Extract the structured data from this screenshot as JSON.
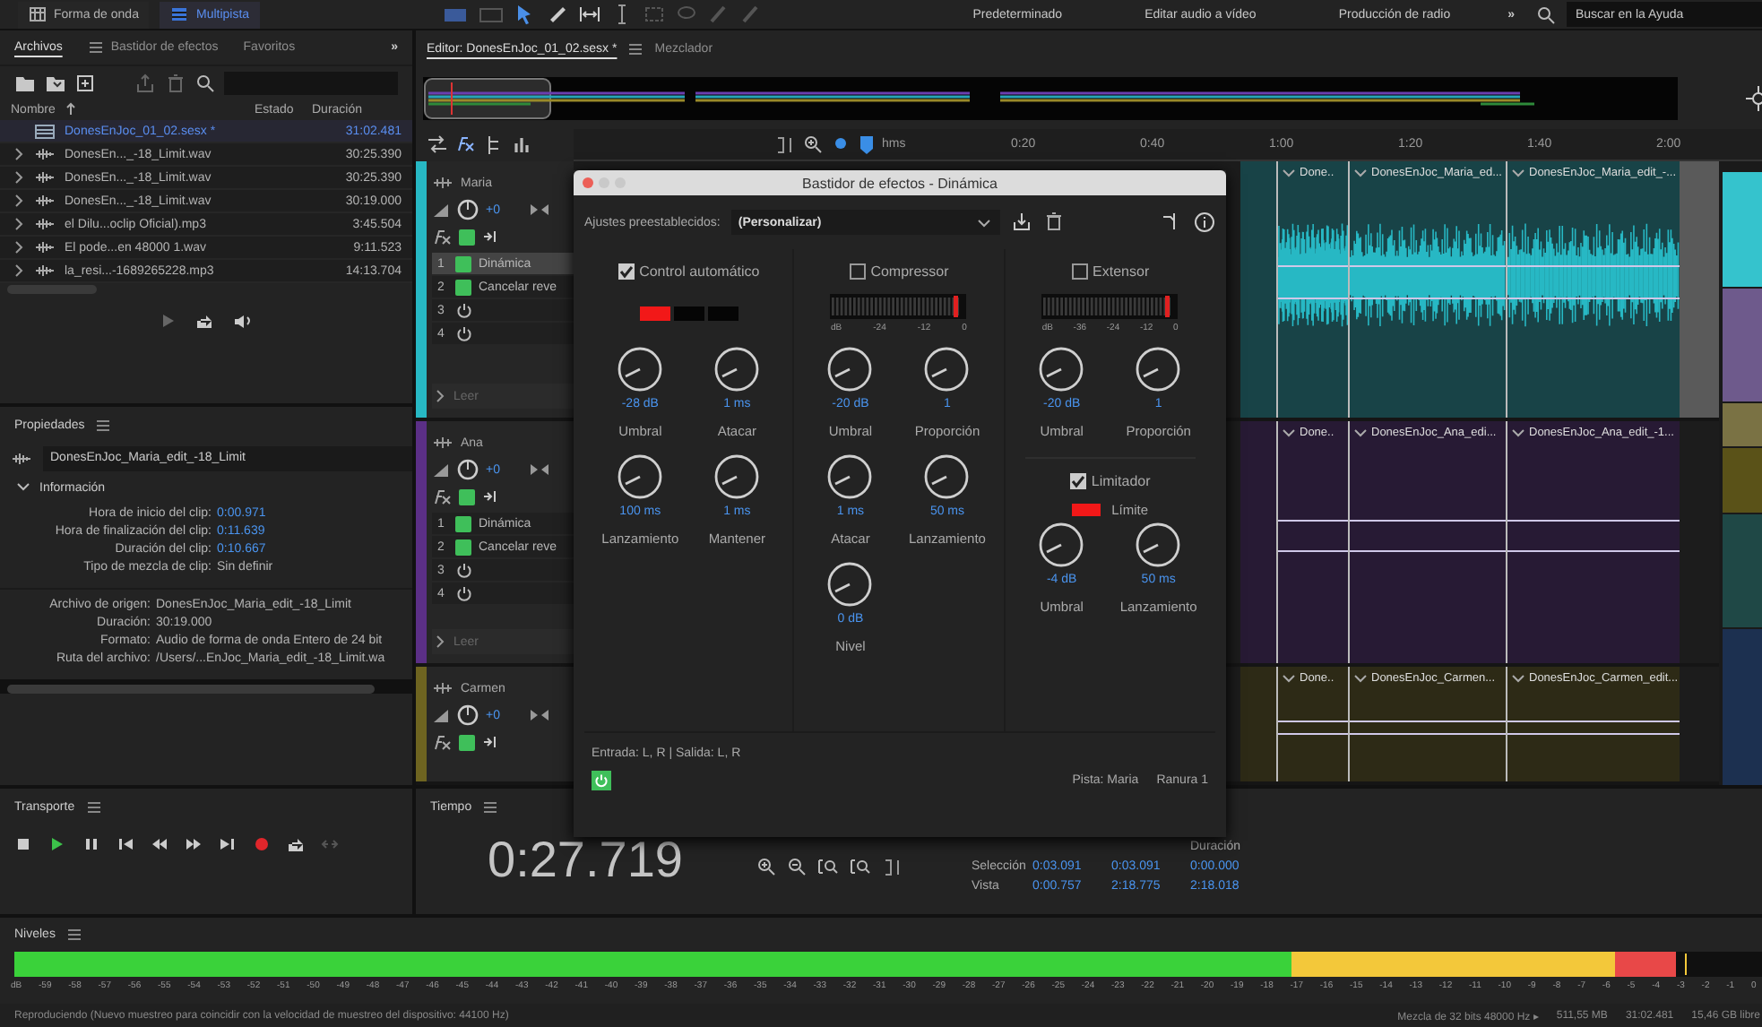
{
  "top_bar": {
    "view_buttons": [
      {
        "label": "Forma de onda",
        "selected": false
      },
      {
        "label": "Multipista",
        "selected": true
      }
    ],
    "workspaces": [
      "Predeterminado",
      "Editar audio a vídeo",
      "Producción de radio"
    ],
    "more": "»",
    "search": {
      "placeholder": "Buscar en la Ayuda"
    }
  },
  "files_panel": {
    "tabs": [
      {
        "label": "Archivos",
        "selected": true
      },
      {
        "label": "Bastidor de efectos",
        "selected": false
      },
      {
        "label": "Favoritos",
        "selected": false
      }
    ],
    "more": "»",
    "columns": [
      "Nombre",
      "Estado",
      "Duración"
    ],
    "rows": [
      {
        "name": "DonesEnJoc_01_02.sesx *",
        "kind": "session",
        "duration": "31:02.481",
        "selected": true
      },
      {
        "name": "DonesEn..._-18_Limit.wav",
        "kind": "audio",
        "duration": "30:25.390",
        "selected": false
      },
      {
        "name": "DonesEn..._-18_Limit.wav",
        "kind": "audio",
        "duration": "30:25.390",
        "selected": false
      },
      {
        "name": "DonesEn..._-18_Limit.wav",
        "kind": "audio",
        "duration": "30:19.000",
        "selected": false
      },
      {
        "name": "el Dilu...oclip Oficial).mp3",
        "kind": "audio",
        "duration": "3:45.504",
        "selected": false
      },
      {
        "name": "El pode...en 48000 1.wav",
        "kind": "audio",
        "duration": "9:11.523",
        "selected": false
      },
      {
        "name": "la_resi...-1689265228.mp3",
        "kind": "audio",
        "duration": "14:13.704",
        "selected": false
      }
    ]
  },
  "properties": {
    "title": "Propiedades",
    "clip_name": "DonesEnJoc_Maria_edit_-18_Limit",
    "section": {
      "label": "Información",
      "expanded": true
    },
    "clip_fields": [
      {
        "label": "Hora de inicio del clip:",
        "value": "0:00.971",
        "kind": "link"
      },
      {
        "label": "Hora de finalización del clip:",
        "value": "0:11.639",
        "kind": "link"
      },
      {
        "label": "Duración del clip:",
        "value": "0:10.667",
        "kind": "link"
      },
      {
        "label": "Tipo de mezcla de clip:",
        "value": "Sin definir",
        "kind": "plain"
      }
    ],
    "file_fields": [
      {
        "label": "Archivo de origen:",
        "value": "DonesEnJoc_Maria_edit_-18_Limit"
      },
      {
        "label": "Duración:",
        "value": "30:19.000"
      },
      {
        "label": "Formato:",
        "value": "Audio de forma de onda Entero de 24 bit"
      },
      {
        "label": "Ruta del archivo:",
        "value": "/Users/...EnJoc_Maria_edit_-18_Limit.wa"
      }
    ]
  },
  "editor": {
    "tabs": [
      {
        "label": "Editor: DonesEnJoc_01_02.sesx *",
        "selected": true
      },
      {
        "label": "Mezclador",
        "selected": false
      }
    ],
    "ruler": [
      "hms",
      "0:20",
      "0:40",
      "1:00",
      "1:20",
      "1:40",
      "2:00"
    ],
    "tracks": [
      {
        "name": "Maria",
        "color": "#27b8c4",
        "volume": "+0",
        "fx_power": true,
        "waveform": true,
        "effects": [
          {
            "slot": "1",
            "kind": "effect",
            "name": "Dinámica",
            "on": true,
            "selected": true
          },
          {
            "slot": "2",
            "kind": "effect",
            "name": "Cancelar reve",
            "on": true,
            "selected": false
          },
          {
            "slot": "3",
            "kind": "empty",
            "selected": false
          },
          {
            "slot": "4",
            "kind": "empty",
            "selected": false
          }
        ],
        "automation": "Leer",
        "clips": [
          "Done..",
          "DonesEnJoc_Maria_ed...",
          "DonesEnJoc_Maria_edit_-..."
        ]
      },
      {
        "name": "Ana",
        "color": "#5b2f86",
        "volume": "+0",
        "fx_power": true,
        "waveform": false,
        "effects": [
          {
            "slot": "1",
            "kind": "effect",
            "name": "Dinámica",
            "on": true,
            "selected": false
          },
          {
            "slot": "2",
            "kind": "effect",
            "name": "Cancelar reve",
            "on": true,
            "selected": false
          },
          {
            "slot": "3",
            "kind": "empty",
            "selected": false
          },
          {
            "slot": "4",
            "kind": "empty",
            "selected": false
          }
        ],
        "automation": "Leer",
        "clips": [
          "Done..",
          "DonesEnJoc_Ana_edi...",
          "DonesEnJoc_Ana_edit_-1..."
        ]
      },
      {
        "name": "Carmen",
        "color": "#6e6420",
        "volume": "+0",
        "fx_power": true,
        "waveform": false,
        "clips": [
          "Done..",
          "DonesEnJoc_Carmen...",
          "DonesEnJoc_Carmen_edit..."
        ]
      }
    ]
  },
  "dialog": {
    "title": "Bastidor de efectos - Dinámica",
    "presets_label": "Ajustes preestablecidos:",
    "preset": "(Personalizar)",
    "sections": [
      {
        "kind": "autogain",
        "label": "Control automático",
        "checked": true,
        "lights": [
          {
            "on": true
          },
          {
            "on": false
          },
          {
            "on": false
          }
        ],
        "knobs": [
          {
            "value": "-28 dB",
            "label": "Umbral"
          },
          {
            "value": "1 ms",
            "label": "Atacar"
          },
          {
            "value": "100 ms",
            "label": "Lanzamiento"
          },
          {
            "value": "1 ms",
            "label": "Mantener"
          }
        ]
      },
      {
        "kind": "meter",
        "label": "Compressor",
        "checked": false,
        "scale": [
          "dB",
          "-24",
          "-12",
          "0"
        ],
        "knobs": [
          {
            "value": "-20 dB",
            "label": "Umbral"
          },
          {
            "value": "1",
            "label": "Proporción"
          },
          {
            "value": "1 ms",
            "label": "Atacar"
          },
          {
            "value": "50 ms",
            "label": "Lanzamiento"
          },
          {
            "value": "0 dB",
            "label": "Nivel"
          }
        ]
      },
      {
        "kind": "meter",
        "label": "Extensor",
        "checked": false,
        "scale": [
          "dB",
          "-36",
          "-24",
          "-12",
          "0"
        ],
        "knobs": [
          {
            "value": "-20 dB",
            "label": "Umbral"
          },
          {
            "value": "1",
            "label": "Proporción"
          }
        ],
        "limiter": {
          "label": "Limitador",
          "checked": true,
          "indicator": {
            "label": "Límite",
            "on": true
          },
          "knobs": [
            {
              "value": "-4 dB",
              "label": "Umbral"
            },
            {
              "value": "50 ms",
              "label": "Lanzamiento"
            }
          ]
        }
      }
    ],
    "io": "Entrada: L, R | Salida: L, R",
    "power_on": true,
    "track": "Pista: Maria",
    "slot": "Ranura 1"
  },
  "transport": {
    "title": "Transporte"
  },
  "time": {
    "title": "Tiempo",
    "display": "0:27.719"
  },
  "selection": {
    "columns": [
      "Duración"
    ],
    "rows": [
      {
        "label": "Selección",
        "values": [
          "0:03.091",
          "0:03.091",
          "0:00.000"
        ]
      },
      {
        "label": "Vista",
        "values": [
          "0:00.757",
          "2:18.775",
          "2:18.018"
        ]
      }
    ]
  },
  "levels": {
    "title": "Niveles",
    "level": 0.95,
    "scale": [
      "dB",
      "-59",
      "-58",
      "-57",
      "-56",
      "-55",
      "-54",
      "-53",
      "-52",
      "-51",
      "-50",
      "-49",
      "-48",
      "-47",
      "-46",
      "-45",
      "-44",
      "-43",
      "-42",
      "-41",
      "-40",
      "-39",
      "-38",
      "-37",
      "-36",
      "-35",
      "-34",
      "-33",
      "-32",
      "-31",
      "-30",
      "-29",
      "-28",
      "-27",
      "-26",
      "-25",
      "-24",
      "-23",
      "-22",
      "-21",
      "-20",
      "-19",
      "-18",
      "-17",
      "-16",
      "-15",
      "-14",
      "-13",
      "-12",
      "-11",
      "-10",
      "-9",
      "-8",
      "-7",
      "-6",
      "-5",
      "-4",
      "-3",
      "-2",
      "-1",
      "0"
    ]
  },
  "status_bar": {
    "message": "Reproduciendo (Nuevo muestreo para coincidir con la velocidad de muestreo del dispositivo: 44100 Hz)",
    "items": [
      "Mezcla de 32 bits 48000 Hz ▸",
      "511,55 MB",
      "31:02.481",
      "15,46 GB libre"
    ]
  }
}
